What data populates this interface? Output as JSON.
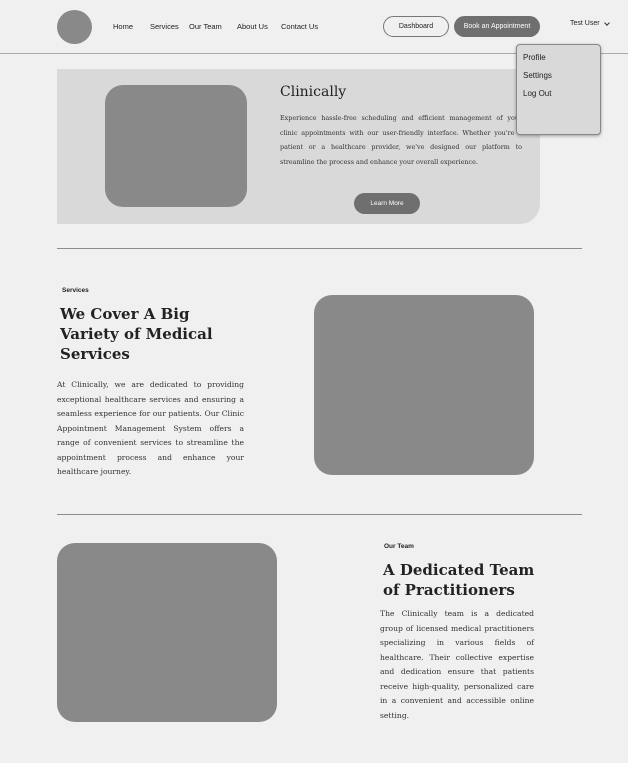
{
  "header": {
    "nav": [
      "Home",
      "Services",
      "Our Team",
      "About Us",
      "Contact Us"
    ],
    "dashboard_label": "Dashboard",
    "book_label": "Book an Appointment",
    "user_name": "Test User"
  },
  "user_dropdown": {
    "items": [
      "Profile",
      "Settings",
      "Log Out"
    ]
  },
  "hero": {
    "title": "Clinically",
    "text": "Experience hassle-free scheduling and efficient management of your clinic appointments with our user-friendly interface. Whether you're a patient or a healthcare provider, we've designed our platform to streamline the process and enhance your overall experience.",
    "button_label": "Learn More"
  },
  "services": {
    "label": "Services",
    "title_lines": [
      "We Cover A Big",
      "Variety of Medical",
      "Services"
    ],
    "text": "At Clinically, we are dedicated to providing exceptional healthcare services and ensuring a seamless experience for our patients. Our Clinic Appointment Management System offers a range of convenient services to streamline the appointment process and enhance your healthcare journey."
  },
  "team": {
    "label": "Our Team",
    "title_lines": [
      "A Dedicated Team",
      "of Practitioners"
    ],
    "text": "The Clinically team is a dedicated group of licensed medical practitioners specializing in various fields of healthcare. Their collective expertise and dedication ensure that patients receive high-quality, personalized care in a convenient and accessible online setting."
  }
}
